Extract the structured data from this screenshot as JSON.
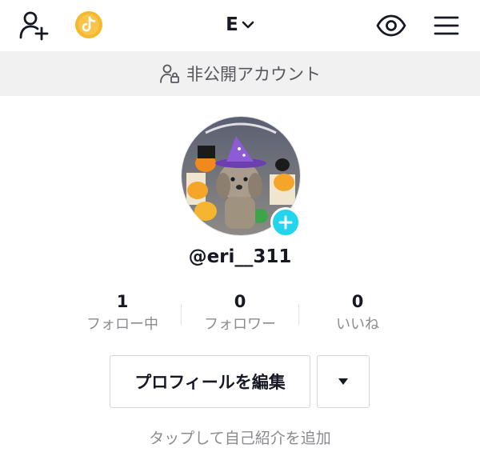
{
  "header": {
    "account_name": "E",
    "icons": {
      "add_user": "add-user-icon",
      "coin": "coin-icon",
      "dropdown": "chevron-down-icon",
      "eye": "eye-icon",
      "menu": "hamburger-menu-icon"
    },
    "coin_color": "#f5b82e"
  },
  "banner": {
    "text": "非公開アカウント",
    "icon": "private-account-icon"
  },
  "profile": {
    "username": "@eri__311",
    "avatar_add_color": "#20d5ec"
  },
  "stats": [
    {
      "value": "1",
      "label": "フォロー中"
    },
    {
      "value": "0",
      "label": "フォロワー"
    },
    {
      "value": "0",
      "label": "いいね"
    }
  ],
  "actions": {
    "edit_profile": "プロフィールを編集",
    "bio_prompt": "タップして自己紹介を追加"
  }
}
